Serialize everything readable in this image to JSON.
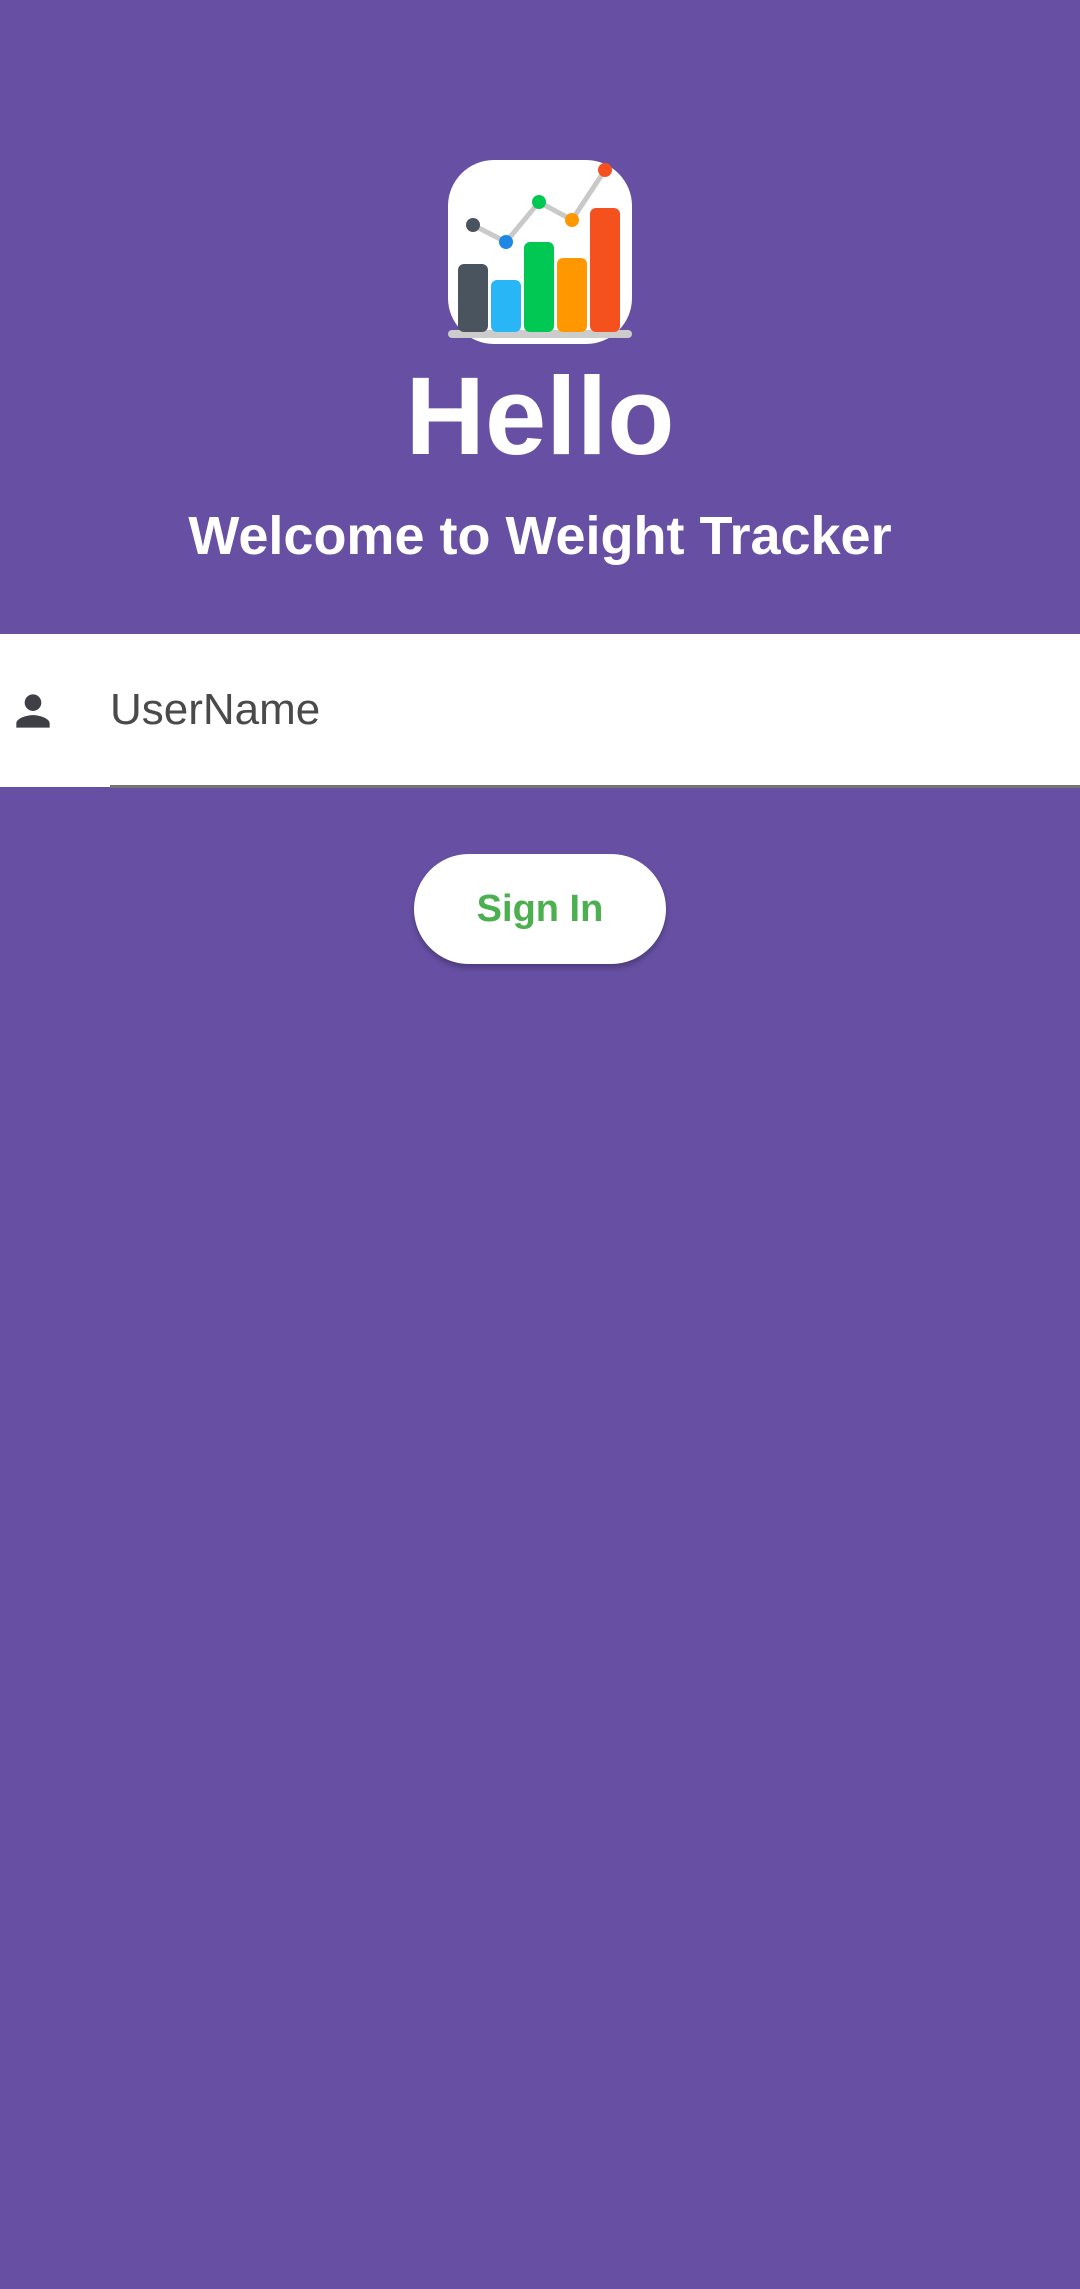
{
  "theme": {
    "background": "#6750a4",
    "heading_color": "#ffffff",
    "field_background": "#ffffff",
    "underline_color": "#757575",
    "icon_color": "#3f3f46",
    "button_text_color": "#4caf50"
  },
  "header": {
    "logo_icon": "bar-line-chart-icon",
    "title": "Hello",
    "subtitle": "Welcome to Weight Tracker"
  },
  "form": {
    "user_icon": "person-icon",
    "username": {
      "value": "",
      "placeholder": "UserName"
    },
    "signin_label": "Sign In"
  }
}
